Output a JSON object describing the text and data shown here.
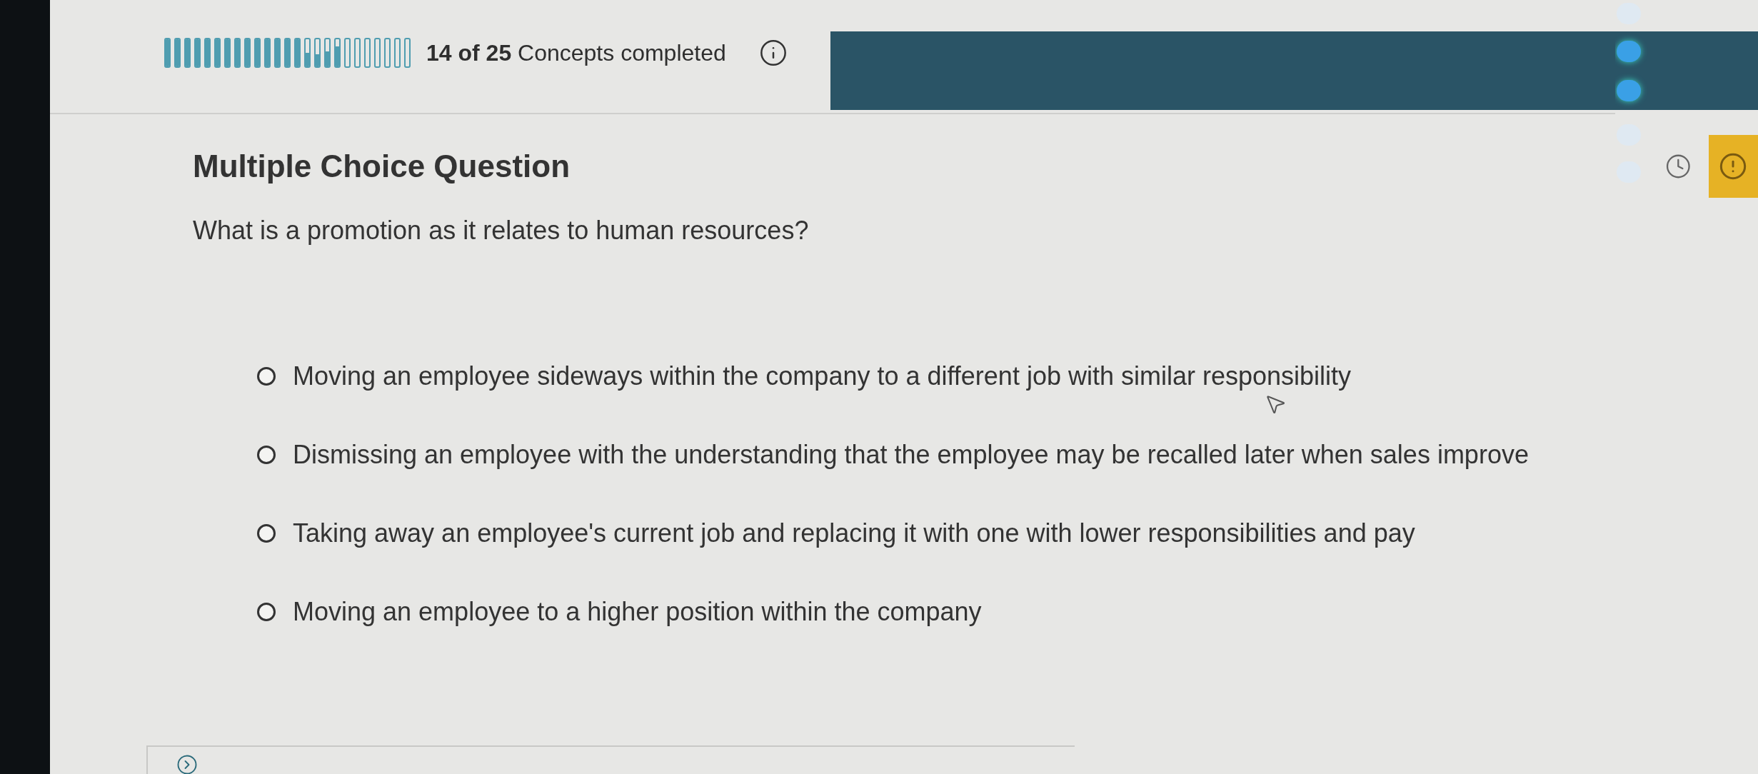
{
  "progress": {
    "segments": [
      {
        "level": 1
      },
      {
        "level": 1
      },
      {
        "level": 1
      },
      {
        "level": 1
      },
      {
        "level": 1
      },
      {
        "level": 1
      },
      {
        "level": 1
      },
      {
        "level": 1
      },
      {
        "level": 1
      },
      {
        "level": 1
      },
      {
        "level": 1
      },
      {
        "level": 1
      },
      {
        "level": 1
      },
      {
        "level": 1
      },
      {
        "level": 0.5
      },
      {
        "level": 0.45
      },
      {
        "level": 0.55
      },
      {
        "level": 0.75
      },
      {
        "level": 0
      },
      {
        "level": 0
      },
      {
        "level": 0
      },
      {
        "level": 0
      },
      {
        "level": 0
      },
      {
        "level": 0
      },
      {
        "level": 0
      }
    ],
    "label": "**14 of 25** Concepts completed"
  },
  "rail_dots": [
    {
      "active": false
    },
    {
      "active": true
    },
    {
      "active": true
    },
    {
      "active": false
    },
    {
      "active": false
    }
  ],
  "question": {
    "type": "Multiple Choice Question",
    "prompt": "What is a promotion as it relates to human resources?",
    "options": [
      {
        "text": "Moving an employee sideways within the company to a different job with similar responsibility",
        "selected": false
      },
      {
        "text": "Dismissing an employee with the understanding that the employee may be recalled later when sales improve",
        "selected": false
      },
      {
        "text": "Taking away an employee's current job and replacing it with one with lower responsibilities and pay",
        "selected": false
      },
      {
        "text": "Moving an employee to a higher position within the company",
        "selected": false
      }
    ]
  }
}
